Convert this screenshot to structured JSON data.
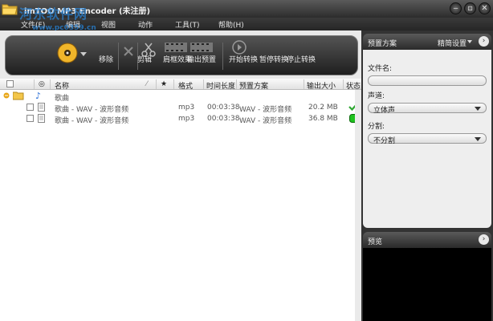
{
  "window": {
    "title": "imTOO MP3 Encoder (未注册)"
  },
  "menu": [
    "文件(F)",
    "编辑",
    "视图",
    "动作",
    "工具(T)",
    "帮助(H)"
  ],
  "watermark": {
    "text": "河东软件网",
    "url": "www.pc0359.cn"
  },
  "toolbar": {
    "remove": "移除",
    "cut": "剪辑",
    "effects": "肩框效果",
    "export_preset": "输出预置",
    "start": "开始转换",
    "pause": "暂停转换",
    "stop": "停止转换"
  },
  "table": {
    "headers": {
      "name": "名称",
      "star": "★",
      "format": "格式",
      "duration": "时间长度",
      "preset": "预置方案",
      "size": "输出大小",
      "status": "状态"
    },
    "group": {
      "name": "歌曲"
    },
    "rows": [
      {
        "name": "歌曲 - WAV - 波形音频",
        "format": "mp3",
        "duration": "00:03:38",
        "preset": "WAV - 波形音频",
        "size": "20.2 MB",
        "status": "done"
      },
      {
        "name": "歌曲 - WAV - 波形音频",
        "format": "mp3",
        "duration": "00:03:38",
        "preset": "WAV - 波形音频",
        "size": "36.8 MB",
        "status": "ready"
      }
    ]
  },
  "preset_panel": {
    "title": "预置方案",
    "settings": "精简设置",
    "filename_label": "文件名:",
    "filename_value": "",
    "channel_label": "声道:",
    "channel_value": "立体声",
    "split_label": "分割:",
    "split_value": "不分割"
  },
  "preview_panel": {
    "title": "预览"
  },
  "colors": {
    "done": "#2fa832",
    "ready": "#1ec21e",
    "accent": "#2a8ae6"
  }
}
